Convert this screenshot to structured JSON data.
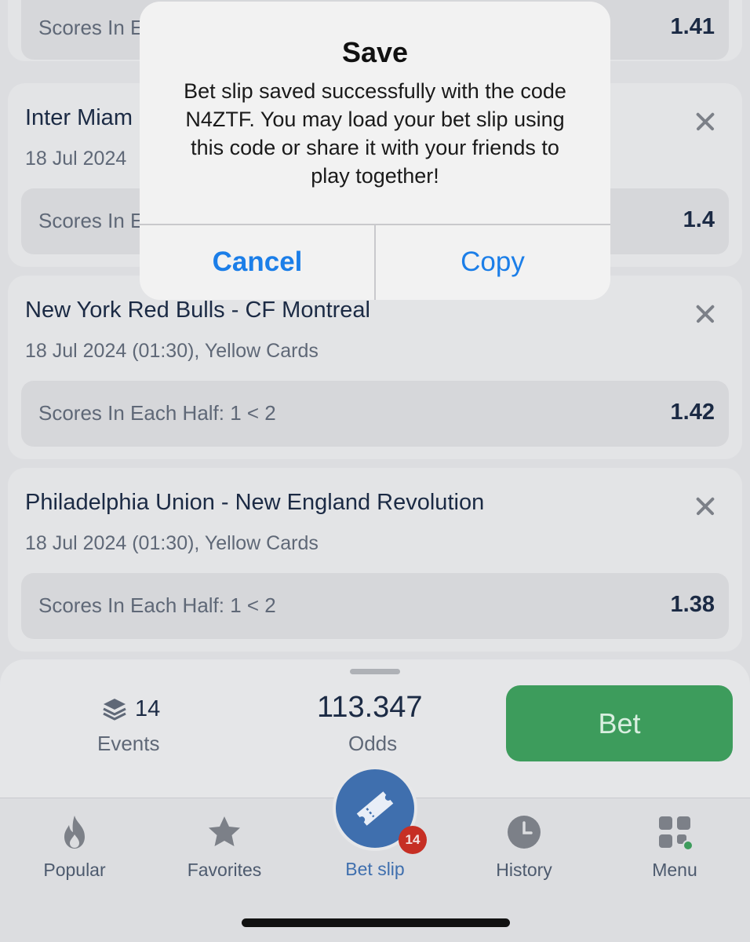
{
  "alert": {
    "title": "Save",
    "message": "Bet slip saved successfully with the code N4ZTF. You may load your bet slip using this code or share it with your friends to play together!",
    "cancel_label": "Cancel",
    "copy_label": "Copy"
  },
  "bets": [
    {
      "title": "",
      "meta": "",
      "pick": "Scores In E",
      "odds": "1.41"
    },
    {
      "title": "Inter Miam",
      "meta": "18 Jul 2024",
      "pick": "Scores In E",
      "odds": "1.4"
    },
    {
      "title": "New York Red Bulls - CF Montreal",
      "meta": "18 Jul 2024 (01:30), Yellow Cards",
      "pick": "Scores In Each Half: 1 < 2",
      "odds": "1.42"
    },
    {
      "title": "Philadelphia Union - New England Revolution",
      "meta": "18 Jul 2024 (01:30), Yellow Cards",
      "pick": "Scores In Each Half: 1 < 2",
      "odds": "1.38"
    }
  ],
  "summary": {
    "events_count": "14",
    "events_label": "Events",
    "odds_value": "113.347",
    "odds_label": "Odds",
    "bet_label": "Bet"
  },
  "tabs": {
    "popular": "Popular",
    "favorites": "Favorites",
    "betslip": "Bet slip",
    "betslip_badge": "14",
    "history": "History",
    "menu": "Menu"
  },
  "colors": {
    "accent_blue": "#1b7ee8",
    "bet_green": "#3d9c5c",
    "badge_red": "#c62f24",
    "betslip_blue": "#3f6fae"
  },
  "icons": [
    "layers-icon",
    "flame-icon",
    "star-icon",
    "ticket-icon",
    "clock-icon",
    "grid-menu-icon",
    "close-icon"
  ]
}
